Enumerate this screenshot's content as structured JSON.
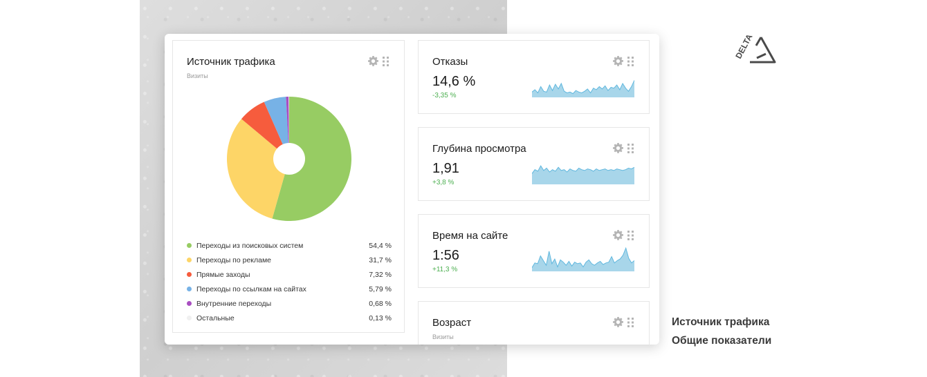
{
  "traffic_widget": {
    "title": "Источник трафика",
    "subtitle": "Визиты",
    "legend": [
      {
        "label": "Переходы из поисковых систем",
        "value": "54,4 %",
        "pct": 54.4,
        "color": "#97cc63"
      },
      {
        "label": "Переходы по рекламе",
        "value": "31,7 %",
        "pct": 31.7,
        "color": "#fdd567"
      },
      {
        "label": "Прямые заходы",
        "value": "7,32 %",
        "pct": 7.32,
        "color": "#f65c3d"
      },
      {
        "label": "Переходы по ссылкам на сайтах",
        "value": "5,79 %",
        "pct": 5.79,
        "color": "#77b2e6"
      },
      {
        "label": "Внутренние переходы",
        "value": "0,68 %",
        "pct": 0.68,
        "color": "#a94ec1"
      },
      {
        "label": "Остальные",
        "value": "0,13 %",
        "pct": 0.13,
        "color": "#f0f0f0"
      }
    ]
  },
  "metrics": [
    {
      "title": "Отказы",
      "value": "14,6 %",
      "change": "-3,35 %",
      "spark": [
        5,
        8,
        4,
        12,
        6,
        5,
        14,
        7,
        15,
        9,
        16,
        6,
        4,
        5,
        3,
        7,
        5,
        4,
        6,
        9,
        4,
        10,
        8,
        12,
        9,
        13,
        7,
        11,
        10,
        14,
        8,
        16,
        10,
        6,
        12,
        20
      ]
    },
    {
      "title": "Глубина просмотра",
      "value": "1,91",
      "change": "+3,8 %",
      "spark": [
        12,
        17,
        15,
        22,
        16,
        19,
        14,
        17,
        15,
        20,
        16,
        17,
        14,
        18,
        16,
        15,
        19,
        17,
        16,
        18,
        17,
        15,
        18,
        16,
        17,
        18,
        16,
        17,
        16,
        18,
        17,
        16,
        17,
        19,
        18,
        20
      ]
    },
    {
      "title": "Время на сайте",
      "value": "1:56",
      "change": "+11,3 %",
      "spark": [
        3,
        9,
        8,
        18,
        12,
        6,
        24,
        8,
        14,
        4,
        13,
        10,
        6,
        11,
        5,
        10,
        8,
        9,
        4,
        10,
        13,
        8,
        6,
        9,
        11,
        7,
        9,
        10,
        17,
        9,
        12,
        14,
        19,
        28,
        15,
        9,
        12
      ]
    },
    {
      "title": "Возраст",
      "subtitle": "Визиты"
    }
  ],
  "brand": {
    "line1": "Источник трафика",
    "line2": "Общие показатели",
    "logo_text": "DELTA"
  },
  "colors": {
    "spark_fill": "#a8d6ea",
    "spark_line": "#5fb7de",
    "positive": "#4caf50",
    "icon": "#b5b5b5"
  },
  "icons": [
    "gear-icon",
    "drag-handle-icon"
  ]
}
